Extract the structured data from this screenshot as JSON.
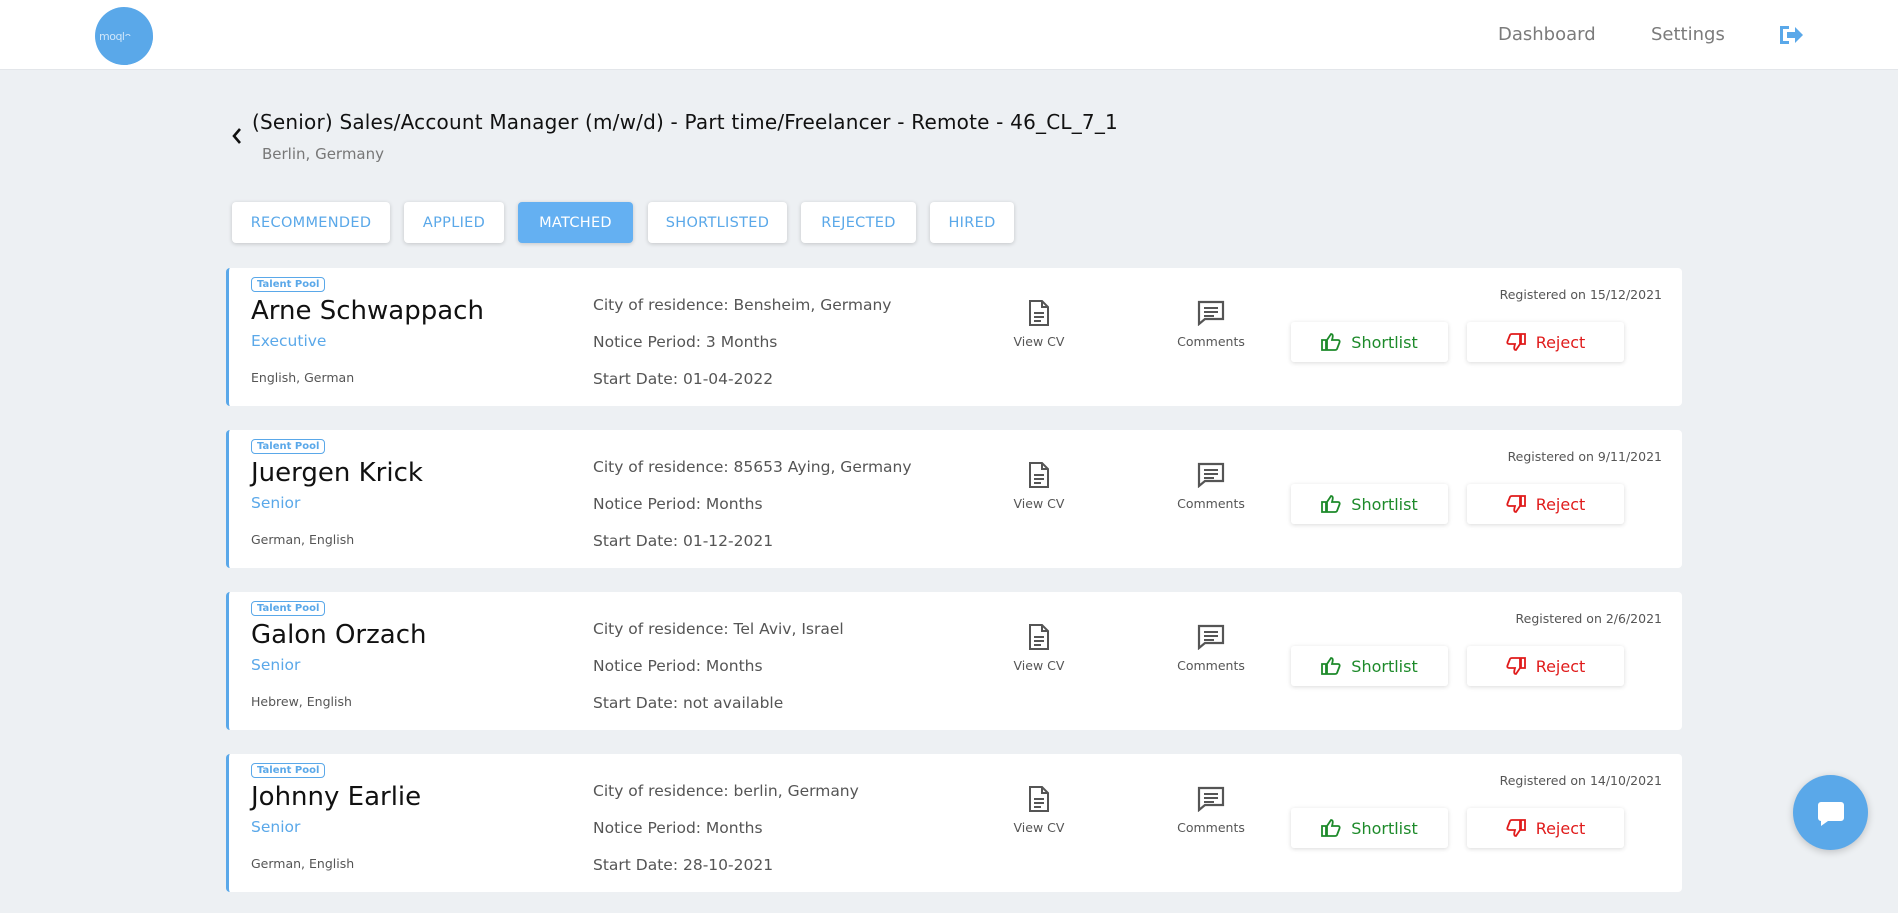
{
  "header": {
    "logo_text": "moqlo",
    "nav": [
      {
        "label": "Dashboard"
      },
      {
        "label": "Settings"
      }
    ]
  },
  "job": {
    "title": "(Senior) Sales/Account Manager (m/w/d) - Part time/Freelancer - Remote - 46_CL_7_1",
    "location": "Berlin, Germany"
  },
  "tabs": [
    {
      "label": "RECOMMENDED"
    },
    {
      "label": "APPLIED"
    },
    {
      "label": "MATCHED",
      "active": true
    },
    {
      "label": "SHORTLISTED"
    },
    {
      "label": "REJECTED"
    },
    {
      "label": "HIRED"
    }
  ],
  "actions": {
    "view_cv": "View CV",
    "comments": "Comments",
    "shortlist": "Shortlist",
    "reject": "Reject"
  },
  "candidates": [
    {
      "badge": "Talent Pool",
      "name": "Arne Schwappach",
      "level": "Executive",
      "languages": "English, German",
      "city": "City of residence: Bensheim, Germany",
      "notice": "Notice Period: 3 Months",
      "start": "Start Date: 01-04-2022",
      "registered": "Registered on 15/12/2021"
    },
    {
      "badge": "Talent Pool",
      "name": "Juergen Krick",
      "level": "Senior",
      "languages": "German, English",
      "city": "City of residence: 85653 Aying, Germany",
      "notice": "Notice Period: Months",
      "start": "Start Date: 01-12-2021",
      "registered": "Registered on 9/11/2021"
    },
    {
      "badge": "Talent Pool",
      "name": "Galon Orzach",
      "level": "Senior",
      "languages": "Hebrew, English",
      "city": "City of residence: Tel Aviv, Israel",
      "notice": "Notice Period: Months",
      "start": "Start Date: not available",
      "registered": "Registered on 2/6/2021"
    },
    {
      "badge": "Talent Pool",
      "name": "Johnny Earlie",
      "level": "Senior",
      "languages": "German, English",
      "city": "City of residence: berlin, Germany",
      "notice": "Notice Period: Months",
      "start": "Start Date: 28-10-2021",
      "registered": "Registered on 14/10/2021"
    }
  ],
  "colors": {
    "accent": "#5aa8e9",
    "shortlist": "#1d8a2a",
    "reject": "#e01b1b",
    "background": "#edf0f3"
  }
}
